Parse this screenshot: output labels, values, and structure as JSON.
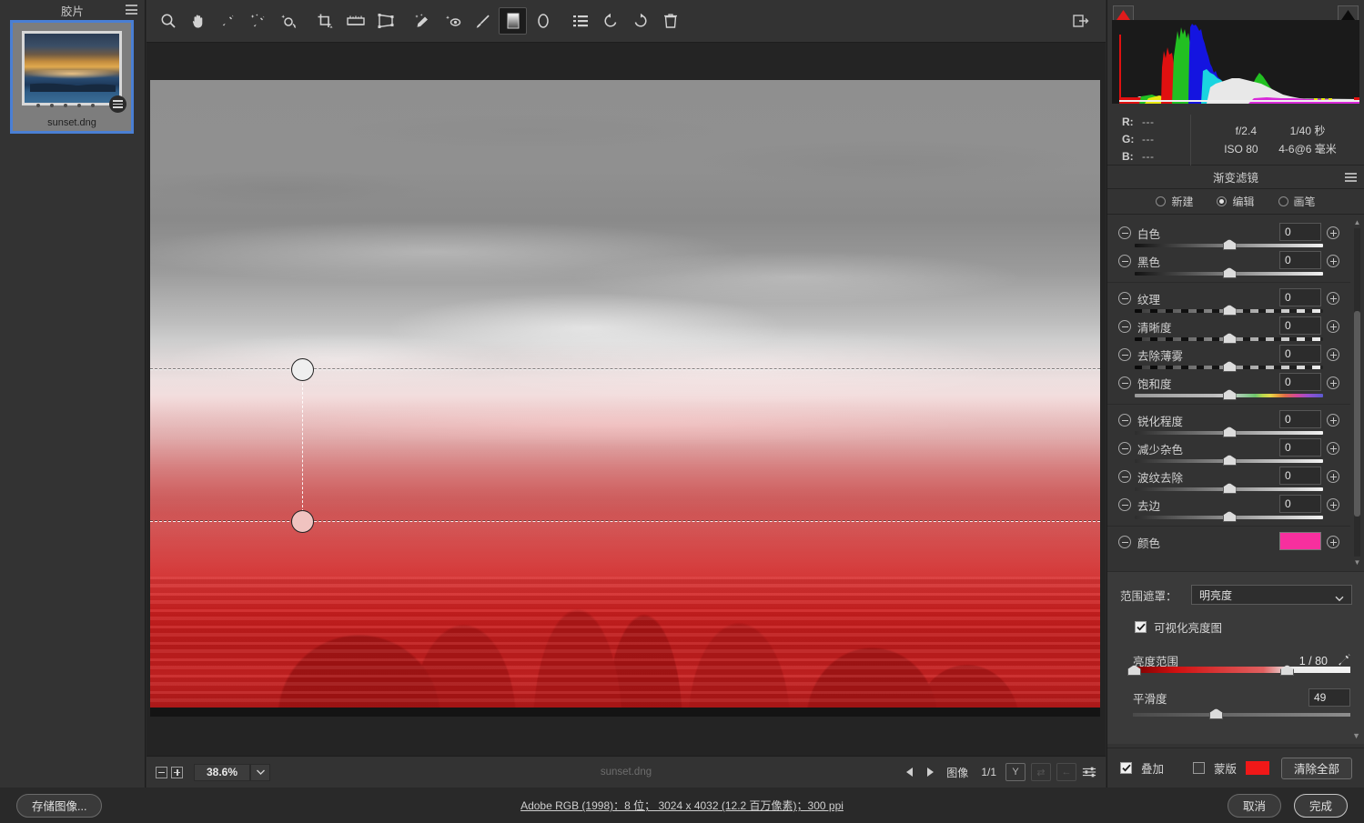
{
  "filmstrip": {
    "title": "胶片",
    "menu_icon": "hamburger-icon",
    "items": [
      {
        "filename": "sunset.dng",
        "selected": true,
        "rating_dots": 5
      }
    ]
  },
  "toolbar": {
    "tools": [
      {
        "name": "zoom-tool",
        "icon": "magnifier-icon"
      },
      {
        "name": "hand-tool",
        "icon": "hand-icon"
      },
      {
        "name": "white-balance-tool",
        "icon": "eyedropper-icon"
      },
      {
        "name": "auto-white-balance-tool",
        "icon": "magic-eyedropper-icon"
      },
      {
        "name": "color-sampler-tool",
        "icon": "target-sampler-icon"
      },
      {
        "name": "crop-tool",
        "icon": "crop-icon"
      },
      {
        "name": "straighten-tool",
        "icon": "straighten-icon"
      },
      {
        "name": "transform-tool",
        "icon": "perspective-icon"
      },
      {
        "name": "spot-removal-tool",
        "icon": "heal-brush-icon"
      },
      {
        "name": "red-eye-tool",
        "icon": "red-eye-icon"
      },
      {
        "name": "adjustment-brush-tool",
        "icon": "brush-icon"
      },
      {
        "name": "graduated-filter-tool",
        "icon": "gradient-icon",
        "active": true
      },
      {
        "name": "radial-filter-tool",
        "icon": "ellipse-icon"
      },
      {
        "name": "presets-tool",
        "icon": "list-icon"
      },
      {
        "name": "rotate-ccw-tool",
        "icon": "rotate-left-icon"
      },
      {
        "name": "rotate-cw-tool",
        "icon": "rotate-right-icon"
      },
      {
        "name": "delete-tool",
        "icon": "trash-icon"
      }
    ],
    "toggle_panel": {
      "name": "toggle-fullscreen-button",
      "icon": "expand-panel-icon"
    }
  },
  "canvas": {
    "filename": "sunset.dng",
    "zoom_level": "38.6%",
    "zoom_out_icon": "minus-box-icon",
    "zoom_in_icon": "plus-box-icon",
    "zoom_dropdown_icon": "chevron-down-icon",
    "prev_icon": "triangle-left-icon",
    "next_icon": "triangle-right-icon",
    "image_counter_label": "图像",
    "image_counter_value": "1/1",
    "buttons": [
      {
        "name": "before-after-button",
        "label": "Y"
      },
      {
        "name": "swap-before-after-button",
        "label": "⇄"
      },
      {
        "name": "copy-settings-button",
        "label": "←"
      },
      {
        "name": "preferences-button",
        "label": "sliders-icon"
      }
    ]
  },
  "histogram": {
    "shadow_clip_icon": "shadow-clip-triangle",
    "highlight_clip_icon": "highlight-clip-triangle",
    "shadow_clip_color": "#e01b1b",
    "highlight_clip_color": "#111111"
  },
  "exif": {
    "r_label": "R:",
    "r_value": "---",
    "g_label": "G:",
    "g_value": "---",
    "b_label": "B:",
    "b_value": "---",
    "aperture": "f/2.4",
    "shutter": "1/40 秒",
    "iso": "ISO 80",
    "focal": "4-6@6 毫米"
  },
  "panel": {
    "title": "渐变滤镜",
    "menu_icon": "hamburger-icon",
    "modes": [
      {
        "label": "新建",
        "selected": false
      },
      {
        "label": "编辑",
        "selected": true
      },
      {
        "label": "画笔",
        "selected": false
      }
    ]
  },
  "sliders": {
    "groups": [
      {
        "rows": [
          {
            "label": "白色",
            "value": "0",
            "track": "dark",
            "thumb_pct": 50
          },
          {
            "label": "黑色",
            "value": "0",
            "track": "dark",
            "thumb_pct": 50
          }
        ]
      },
      {
        "rows": [
          {
            "label": "纹理",
            "value": "0",
            "track": "seg",
            "thumb_pct": 50
          },
          {
            "label": "清晰度",
            "value": "0",
            "track": "seg",
            "thumb_pct": 50
          },
          {
            "label": "去除薄雾",
            "value": "0",
            "track": "seg",
            "thumb_pct": 50
          },
          {
            "label": "饱和度",
            "value": "0",
            "track": "sat",
            "thumb_pct": 50
          }
        ]
      },
      {
        "rows": [
          {
            "label": "锐化程度",
            "value": "0",
            "track": "plain",
            "thumb_pct": 50
          },
          {
            "label": "减少杂色",
            "value": "0",
            "track": "plain",
            "thumb_pct": 50
          },
          {
            "label": "波纹去除",
            "value": "0",
            "track": "plain",
            "thumb_pct": 50
          },
          {
            "label": "去边",
            "value": "0",
            "track": "plain",
            "thumb_pct": 50
          }
        ]
      },
      {
        "rows": [
          {
            "label": "颜色",
            "value": "",
            "swatch": "#f72f9e",
            "track": null
          }
        ]
      }
    ],
    "minus_icon": "minus-circle-icon",
    "plus_icon": "plus-circle-icon"
  },
  "range_mask": {
    "label": "范围遮罩：",
    "selected": "明亮度",
    "caret_icon": "chevron-down-icon",
    "visualize": {
      "label": "可视化亮度图",
      "checked": true
    },
    "luminance_range": {
      "label": "亮度范围",
      "value": "1 / 80",
      "eyedropper_icon": "eyedropper-icon",
      "low_pct": 1,
      "high_pct": 80
    },
    "smoothness": {
      "label": "平滑度",
      "value": "49",
      "thumb_pct": 49
    }
  },
  "panel_footer": {
    "overlay": {
      "label": "叠加",
      "checked": true
    },
    "mask": {
      "label": "蒙版",
      "checked": false,
      "color": "#f01818"
    },
    "clear_all": "清除全部"
  },
  "app_footer": {
    "save_button": "存储图像...",
    "info_text": "Adobe RGB (1998)：8 位； 3024 x 4032 (12.2 百万像素)；300 ppi",
    "cancel_button": "取消",
    "done_button": "完成"
  }
}
